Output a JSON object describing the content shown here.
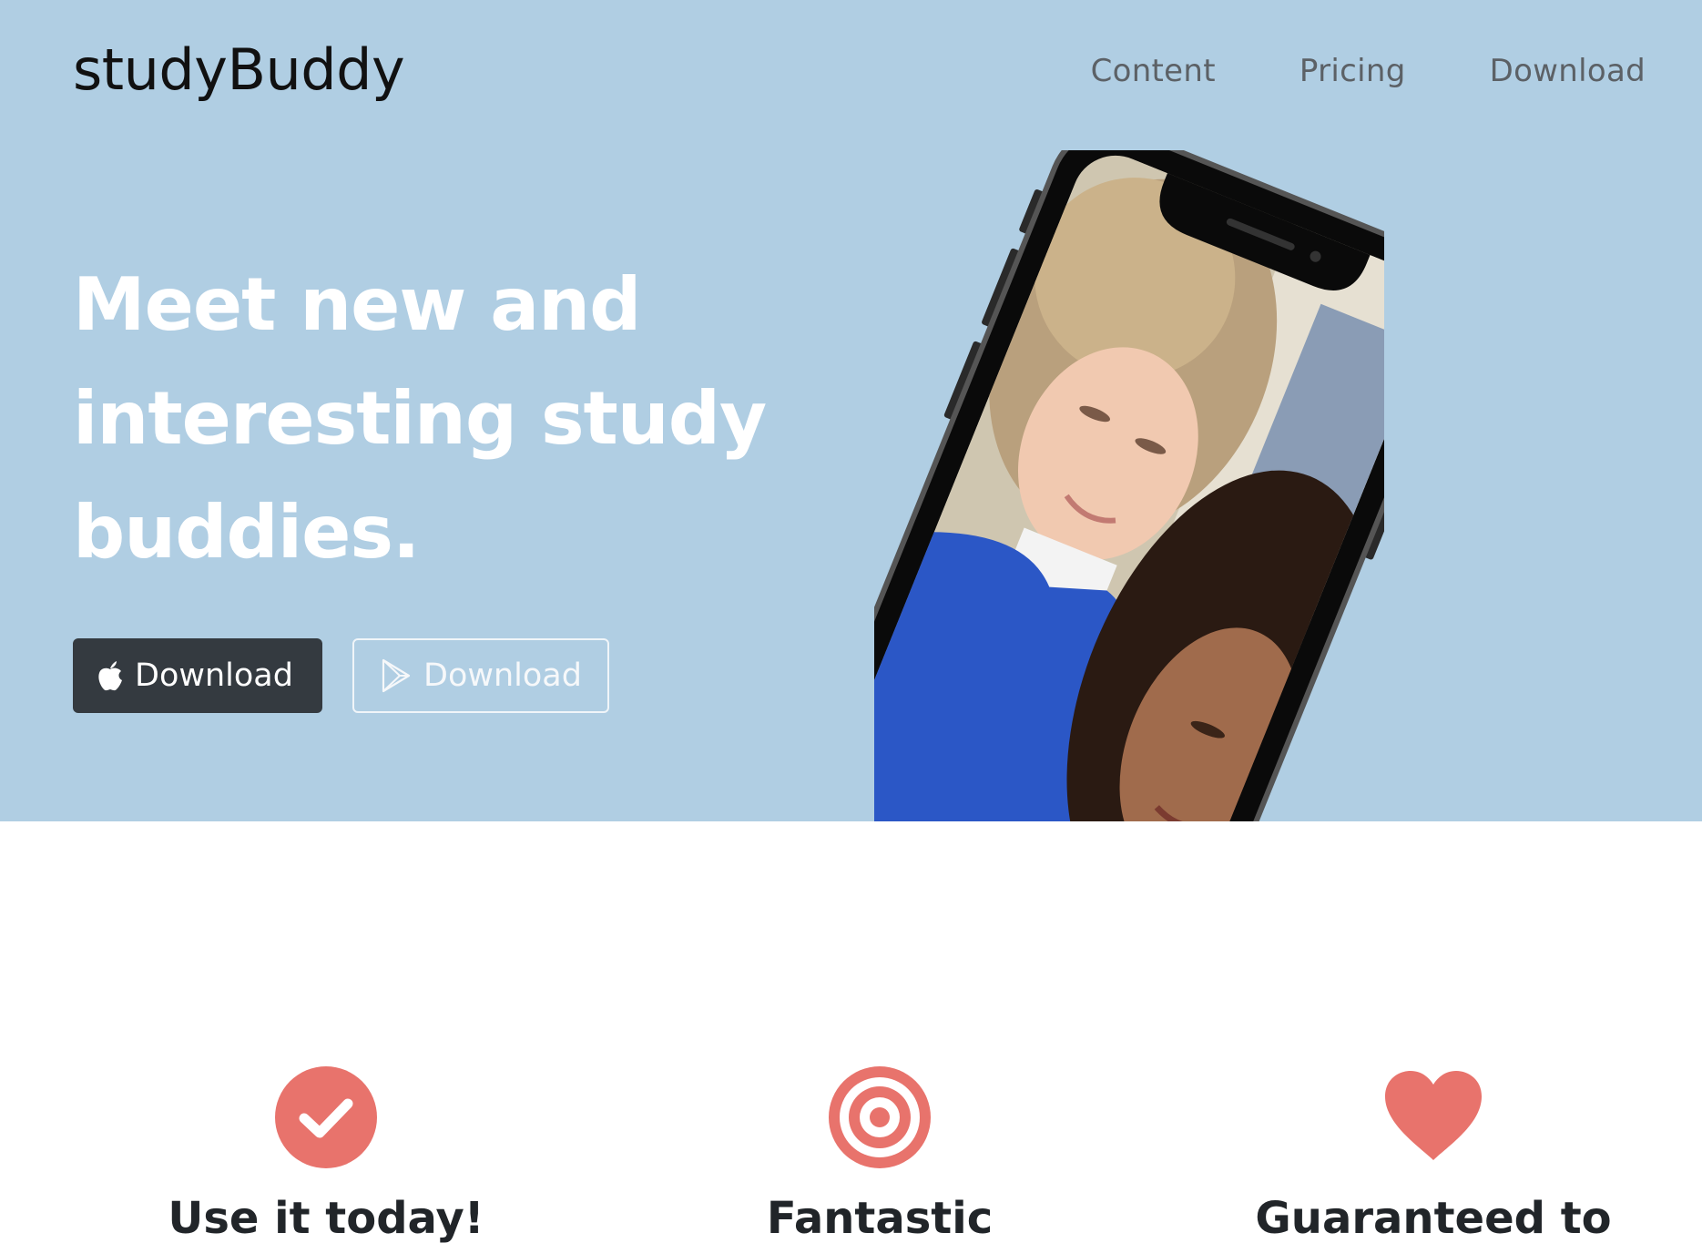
{
  "brand": {
    "name": "studyBuddy"
  },
  "nav": {
    "items": [
      {
        "label": "Content"
      },
      {
        "label": "Pricing"
      },
      {
        "label": "Download"
      }
    ]
  },
  "hero": {
    "headline_lines": [
      "Meet new and",
      "interesting study",
      "buddies."
    ],
    "apple_button": {
      "label": "Download",
      "icon": "apple-icon"
    },
    "play_button": {
      "label": "Download",
      "icon": "google-play-icon"
    },
    "image": "phone-mockup-two-students"
  },
  "features": [
    {
      "icon": "check-circle-icon",
      "title": "Use it today!"
    },
    {
      "icon": "bullseye-icon",
      "title": "Fantastic"
    },
    {
      "icon": "heart-icon",
      "title": "Guaranteed to"
    }
  ],
  "colors": {
    "hero_bg": "#b0cee3",
    "accent": "#e8736c",
    "dark_button": "#343a40",
    "text_dark": "#212529"
  }
}
